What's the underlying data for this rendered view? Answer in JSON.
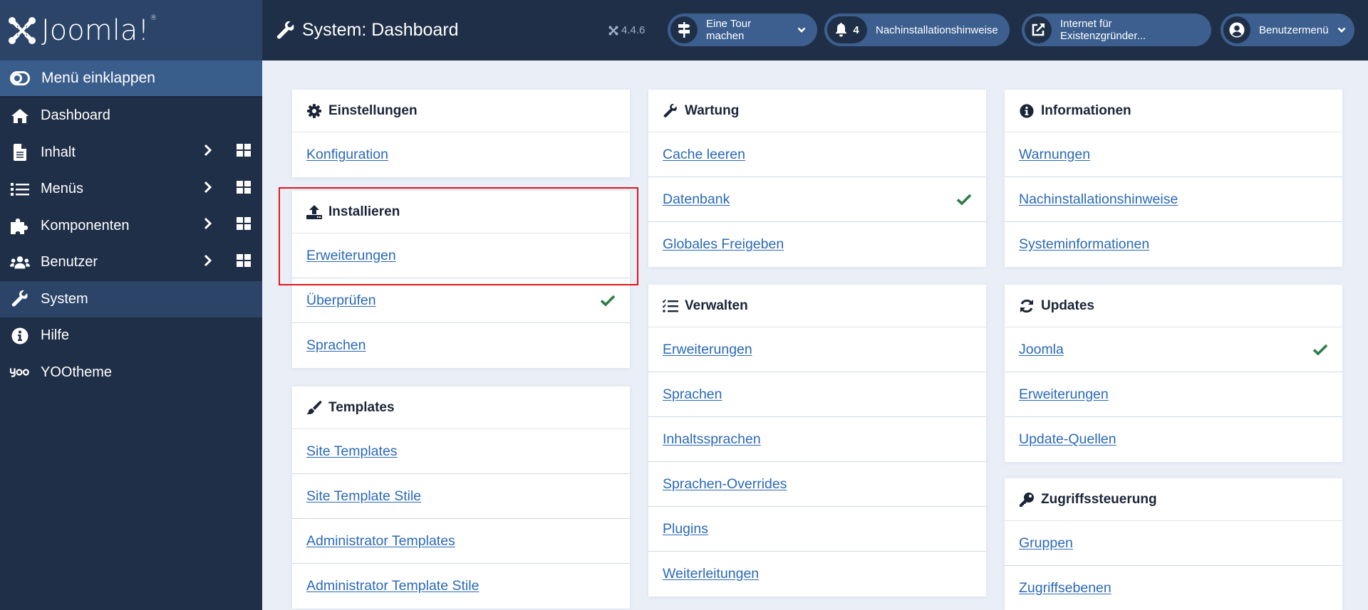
{
  "app": {
    "logo_text": "Joomla!",
    "brand_colors": {
      "sidebar_bg": "#1f2f47",
      "accent": "#3c5f8f",
      "link": "#2a69b8",
      "check": "#2e7d46",
      "highlight": "#e6141b"
    }
  },
  "sidebar": {
    "toggle_label": "Menü einklappen",
    "items": [
      {
        "label": "Dashboard",
        "icon": "home-icon",
        "has_submenu": false,
        "active": false
      },
      {
        "label": "Inhalt",
        "icon": "file-icon",
        "has_submenu": true,
        "active": false
      },
      {
        "label": "Menüs",
        "icon": "list-icon",
        "has_submenu": true,
        "active": false
      },
      {
        "label": "Komponenten",
        "icon": "puzzle-icon",
        "has_submenu": true,
        "active": false
      },
      {
        "label": "Benutzer",
        "icon": "users-icon",
        "has_submenu": true,
        "active": false
      },
      {
        "label": "System",
        "icon": "wrench-icon",
        "has_submenu": false,
        "active": true
      },
      {
        "label": "Hilfe",
        "icon": "info-circle-icon",
        "has_submenu": false,
        "active": false
      },
      {
        "label": "YOOtheme",
        "icon": "yoo-icon",
        "has_submenu": false,
        "active": false
      }
    ]
  },
  "header": {
    "title": "System: Dashboard",
    "version": "4.4.6",
    "tour_label": "Eine Tour machen",
    "notifications_count": "4",
    "notifications_label": "Nachinstallationshinweise",
    "site_link_label": "Internet für Existenzgründer...",
    "user_menu_label": "Benutzermenü"
  },
  "cards": {
    "einstellungen": {
      "title": "Einstellungen",
      "links": [
        {
          "label": "Konfiguration",
          "checked": false
        }
      ]
    },
    "installieren": {
      "title": "Installieren",
      "links": [
        {
          "label": "Erweiterungen",
          "checked": false
        },
        {
          "label": "Überprüfen",
          "checked": true
        },
        {
          "label": "Sprachen",
          "checked": false
        }
      ]
    },
    "templates": {
      "title": "Templates",
      "links": [
        {
          "label": "Site Templates"
        },
        {
          "label": "Site Template Stile"
        },
        {
          "label": "Administrator Templates"
        },
        {
          "label": "Administrator Template Stile"
        }
      ]
    },
    "wartung": {
      "title": "Wartung",
      "links": [
        {
          "label": "Cache leeren",
          "checked": false
        },
        {
          "label": "Datenbank",
          "checked": true
        },
        {
          "label": "Globales Freigeben",
          "checked": false
        }
      ]
    },
    "verwalten": {
      "title": "Verwalten",
      "links": [
        {
          "label": "Erweiterungen"
        },
        {
          "label": "Sprachen"
        },
        {
          "label": "Inhaltssprachen"
        },
        {
          "label": "Sprachen-Overrides"
        },
        {
          "label": "Plugins"
        },
        {
          "label": "Weiterleitungen"
        }
      ]
    },
    "informationen": {
      "title": "Informationen",
      "links": [
        {
          "label": "Warnungen"
        },
        {
          "label": "Nachinstallationshinweise"
        },
        {
          "label": "Systeminformationen"
        }
      ]
    },
    "updates": {
      "title": "Updates",
      "links": [
        {
          "label": "Joomla",
          "checked": true
        },
        {
          "label": "Erweiterungen",
          "checked": false
        },
        {
          "label": "Update-Quellen",
          "checked": false
        }
      ]
    },
    "zugriff": {
      "title": "Zugriffssteuerung",
      "links": [
        {
          "label": "Gruppen"
        },
        {
          "label": "Zugriffsebenen"
        }
      ]
    }
  }
}
